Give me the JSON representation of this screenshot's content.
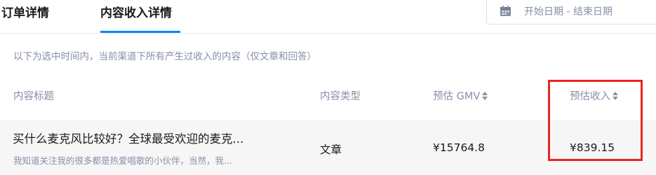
{
  "tabs": {
    "orders_label": "订单详情",
    "content_income_label": "内容收入详情"
  },
  "date_range": {
    "text": "开始日期  -  结束日期",
    "icon": "calendar-icon"
  },
  "hint": "以下为选中时间内，当前渠道下所有产生过收入的内容（仅文章和回答）",
  "table": {
    "headers": {
      "title": "内容标题",
      "type": "内容类型",
      "gmv": "预估 GMV",
      "income": "预估收入"
    },
    "rows": [
      {
        "title": "买什么麦克风比较好？全球最受欢迎的麦克...",
        "excerpt": "我知道关注我的很多都是热爱唱歌的小伙伴，当然，我...",
        "type": "文章",
        "gmv": "¥15764.8",
        "income": "¥839.15"
      }
    ]
  },
  "colors": {
    "accent": "#0a84ff",
    "muted_text": "#8590a6",
    "highlight_border": "#e8261c",
    "row_bg": "#f6f6f6"
  }
}
